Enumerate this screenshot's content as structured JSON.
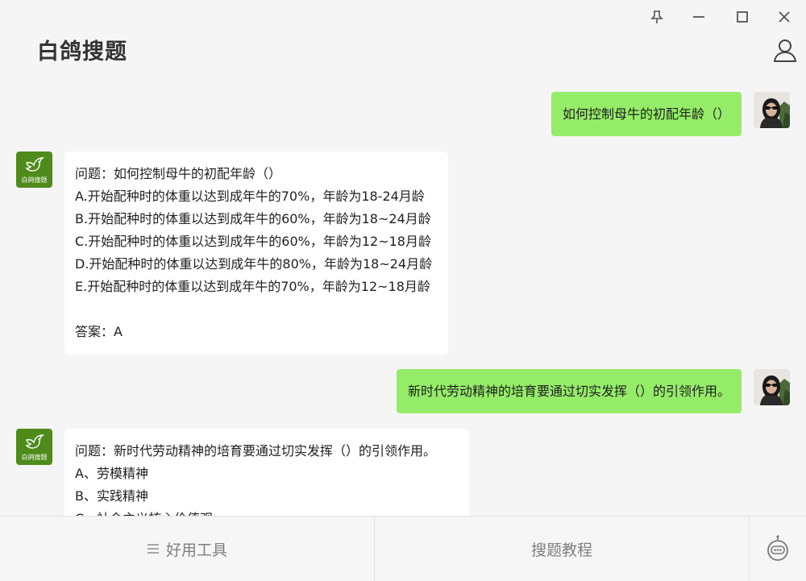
{
  "window": {
    "pin_icon": "pin-icon",
    "minimize_icon": "minimize-icon",
    "maximize_icon": "maximize-icon",
    "close_icon": "close-icon"
  },
  "header": {
    "title": "白鸽搜题",
    "user_icon": "user-icon"
  },
  "messages": [
    {
      "role": "user",
      "text": "如何控制母牛的初配年龄（）"
    },
    {
      "role": "bot",
      "avatar_label": "白鸽搜题",
      "lines": [
        "问题：如何控制母牛的初配年龄（）",
        "A.开始配种时的体重以达到成年牛的70%，年龄为18-24月龄",
        "B.开始配种时的体重以达到成年牛的60%，年龄为18~24月龄",
        "C.开始配种时的体重以达到成年牛的60%，年龄为12~18月龄",
        "D.开始配种时的体重以达到成年牛的80%，年龄为18~24月龄",
        "E.开始配种时的体重以达到成年牛的70%，年龄为12~18月龄",
        "",
        "答案：A"
      ]
    },
    {
      "role": "user",
      "text": "新时代劳动精神的培育要通过切实发挥（）的引领作用。"
    },
    {
      "role": "bot",
      "avatar_label": "白鸽搜题",
      "lines": [
        "问题：新时代劳动精神的培育要通过切实发挥（）的引领作用。",
        "A、劳模精神",
        "B、实践精神",
        "C、社会主义核心价值观"
      ]
    }
  ],
  "bottombar": {
    "tools_label": "好用工具",
    "tutorial_label": "搜题教程",
    "tools_icon": "menu-icon",
    "robot_icon": "robot-icon"
  },
  "colors": {
    "user_bubble": "#95ec69",
    "bot_avatar": "#4f8b1a",
    "background": "#f5f5f5"
  }
}
